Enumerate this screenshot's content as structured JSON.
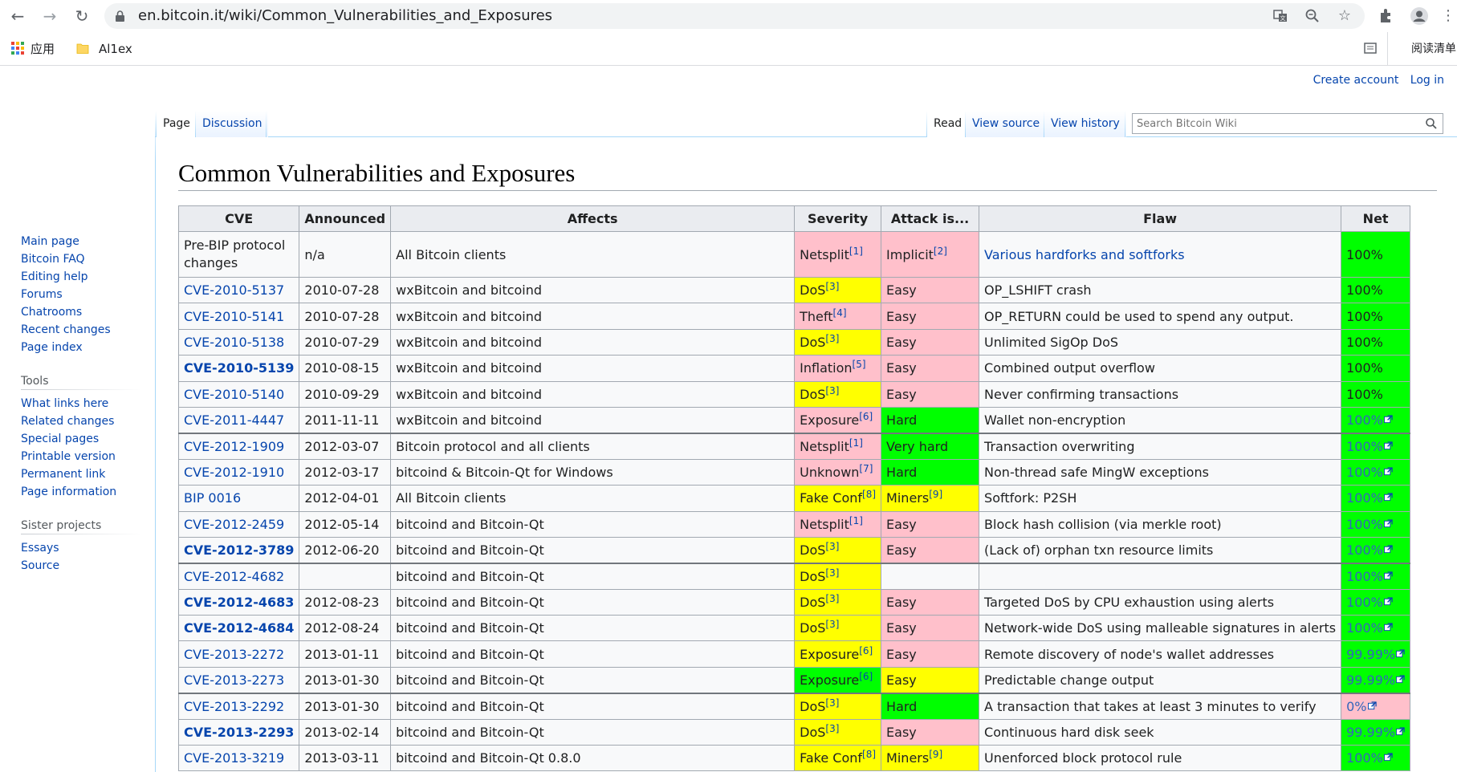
{
  "browser": {
    "url": "en.bitcoin.it/wiki/Common_Vulnerabilities_and_Exposures",
    "bookmarks": [
      {
        "label": "应用",
        "icon": "apps-grid-icon"
      },
      {
        "label": "Al1ex",
        "icon": "folder-icon"
      }
    ],
    "reading_list_label": "阅读清单"
  },
  "personal_tools": {
    "create_account": "Create account",
    "log_in": "Log in"
  },
  "tabs": {
    "page": "Page",
    "discussion": "Discussion",
    "read": "Read",
    "view_source": "View source",
    "view_history": "View history"
  },
  "search": {
    "placeholder": "Search Bitcoin Wiki"
  },
  "sidebar": {
    "navigation": [
      "Main page",
      "Bitcoin FAQ",
      "Editing help",
      "Forums",
      "Chatrooms",
      "Recent changes",
      "Page index"
    ],
    "tools_heading": "Tools",
    "tools": [
      "What links here",
      "Related changes",
      "Special pages",
      "Printable version",
      "Permanent link",
      "Page information"
    ],
    "sister_heading": "Sister projects",
    "sister": [
      "Essays",
      "Source"
    ]
  },
  "title": "Common Vulnerabilities and Exposures",
  "table": {
    "headers": [
      "CVE",
      "Announced",
      "Affects",
      "Severity",
      "Attack is...",
      "Flaw",
      "Net"
    ],
    "colors": {
      "pink": "#ffc0cb",
      "yellow": "#ffff00",
      "green": "#00ff00",
      "plain": "#f8f9fa"
    },
    "rows": [
      {
        "cve": "Pre-BIP protocol changes",
        "cve_link": false,
        "bold": false,
        "date": "n/a",
        "affects": "All Bitcoin clients",
        "severity": "Netsplit",
        "sev_ref": "[1]",
        "sev_color": "pink",
        "attack": "Implicit",
        "att_ref": "[2]",
        "att_color": "pink",
        "flaw": "Various hardforks and softforks",
        "flaw_link": true,
        "net": "100%",
        "net_ext": false,
        "net_color": "green",
        "tall": true
      },
      {
        "cve": "CVE-2010-5137",
        "cve_link": true,
        "bold": false,
        "date": "2010-07-28",
        "affects": "wxBitcoin and bitcoind",
        "severity": "DoS",
        "sev_ref": "[3]",
        "sev_color": "yellow",
        "attack": "Easy",
        "att_ref": "",
        "att_color": "pink",
        "flaw": "OP_LSHIFT crash",
        "flaw_link": false,
        "net": "100%",
        "net_ext": false,
        "net_color": "green"
      },
      {
        "cve": "CVE-2010-5141",
        "cve_link": true,
        "bold": false,
        "date": "2010-07-28",
        "affects": "wxBitcoin and bitcoind",
        "severity": "Theft",
        "sev_ref": "[4]",
        "sev_color": "pink",
        "attack": "Easy",
        "att_ref": "",
        "att_color": "pink",
        "flaw": "OP_RETURN could be used to spend any output.",
        "flaw_link": false,
        "net": "100%",
        "net_ext": false,
        "net_color": "green"
      },
      {
        "cve": "CVE-2010-5138",
        "cve_link": true,
        "bold": false,
        "date": "2010-07-29",
        "affects": "wxBitcoin and bitcoind",
        "severity": "DoS",
        "sev_ref": "[3]",
        "sev_color": "yellow",
        "attack": "Easy",
        "att_ref": "",
        "att_color": "pink",
        "flaw": "Unlimited SigOp DoS",
        "flaw_link": false,
        "net": "100%",
        "net_ext": false,
        "net_color": "green"
      },
      {
        "cve": "CVE-2010-5139",
        "cve_link": true,
        "bold": true,
        "date": "2010-08-15",
        "affects": "wxBitcoin and bitcoind",
        "severity": "Inflation",
        "sev_ref": "[5]",
        "sev_color": "pink",
        "attack": "Easy",
        "att_ref": "",
        "att_color": "pink",
        "flaw": "Combined output overflow",
        "flaw_link": false,
        "net": "100%",
        "net_ext": false,
        "net_color": "green"
      },
      {
        "cve": "CVE-2010-5140",
        "cve_link": true,
        "bold": false,
        "date": "2010-09-29",
        "affects": "wxBitcoin and bitcoind",
        "severity": "DoS",
        "sev_ref": "[3]",
        "sev_color": "yellow",
        "attack": "Easy",
        "att_ref": "",
        "att_color": "pink",
        "flaw": "Never confirming transactions",
        "flaw_link": false,
        "net": "100%",
        "net_ext": false,
        "net_color": "green"
      },
      {
        "cve": "CVE-2011-4447",
        "cve_link": true,
        "bold": false,
        "date": "2011-11-11",
        "affects": "wxBitcoin and bitcoind",
        "severity": "Exposure",
        "sev_ref": "[6]",
        "sev_color": "pink",
        "attack": "Hard",
        "att_ref": "",
        "att_color": "green",
        "flaw": "Wallet non-encryption",
        "flaw_link": false,
        "net": "100%",
        "net_ext": true,
        "net_color": "green"
      },
      {
        "cve": "CVE-2012-1909",
        "cve_link": true,
        "bold": false,
        "date": "2012-03-07",
        "affects": "Bitcoin protocol and all clients",
        "severity": "Netsplit",
        "sev_ref": "[1]",
        "sev_color": "pink",
        "attack": "Very hard",
        "att_ref": "",
        "att_color": "green",
        "flaw": "Transaction overwriting",
        "flaw_link": false,
        "net": "100%",
        "net_ext": true,
        "net_color": "green",
        "thick": true
      },
      {
        "cve": "CVE-2012-1910",
        "cve_link": true,
        "bold": false,
        "date": "2012-03-17",
        "affects": "bitcoind & Bitcoin-Qt for Windows",
        "severity": "Unknown",
        "sev_ref": "[7]",
        "sev_color": "pink",
        "attack": "Hard",
        "att_ref": "",
        "att_color": "green",
        "flaw": "Non-thread safe MingW exceptions",
        "flaw_link": false,
        "net": "100%",
        "net_ext": true,
        "net_color": "green"
      },
      {
        "cve": "BIP 0016",
        "cve_link": true,
        "bold": false,
        "date": "2012-04-01",
        "affects": "All Bitcoin clients",
        "severity": "Fake Conf",
        "sev_ref": "[8]",
        "sev_color": "yellow",
        "attack": "Miners",
        "att_ref": "[9]",
        "att_color": "yellow",
        "flaw": "Softfork: P2SH",
        "flaw_link": false,
        "net": "100%",
        "net_ext": true,
        "net_color": "green"
      },
      {
        "cve": "CVE-2012-2459",
        "cve_link": true,
        "bold": false,
        "date": "2012-05-14",
        "affects": "bitcoind and Bitcoin-Qt",
        "severity": "Netsplit",
        "sev_ref": "[1]",
        "sev_color": "pink",
        "attack": "Easy",
        "att_ref": "",
        "att_color": "pink",
        "flaw": "Block hash collision (via merkle root)",
        "flaw_link": false,
        "net": "100%",
        "net_ext": true,
        "net_color": "green"
      },
      {
        "cve": "CVE-2012-3789",
        "cve_link": true,
        "bold": true,
        "date": "2012-06-20",
        "affects": "bitcoind and Bitcoin-Qt",
        "severity": "DoS",
        "sev_ref": "[3]",
        "sev_color": "yellow",
        "attack": "Easy",
        "att_ref": "",
        "att_color": "pink",
        "flaw": "(Lack of) orphan txn resource limits",
        "flaw_link": false,
        "net": "100%",
        "net_ext": true,
        "net_color": "green"
      },
      {
        "cve": "CVE-2012-4682",
        "cve_link": true,
        "bold": false,
        "date": "",
        "affects": "bitcoind and Bitcoin-Qt",
        "severity": "DoS",
        "sev_ref": "[3]",
        "sev_color": "yellow",
        "attack": "",
        "att_ref": "",
        "att_color": "plain",
        "flaw": "",
        "flaw_link": false,
        "net": "100%",
        "net_ext": true,
        "net_color": "green",
        "thick": true
      },
      {
        "cve": "CVE-2012-4683",
        "cve_link": true,
        "bold": true,
        "date": "2012-08-23",
        "affects": "bitcoind and Bitcoin-Qt",
        "severity": "DoS",
        "sev_ref": "[3]",
        "sev_color": "yellow",
        "attack": "Easy",
        "att_ref": "",
        "att_color": "pink",
        "flaw": "Targeted DoS by CPU exhaustion using alerts",
        "flaw_link": false,
        "net": "100%",
        "net_ext": true,
        "net_color": "green"
      },
      {
        "cve": "CVE-2012-4684",
        "cve_link": true,
        "bold": true,
        "date": "2012-08-24",
        "affects": "bitcoind and Bitcoin-Qt",
        "severity": "DoS",
        "sev_ref": "[3]",
        "sev_color": "yellow",
        "attack": "Easy",
        "att_ref": "",
        "att_color": "pink",
        "flaw": "Network-wide DoS using malleable signatures in alerts",
        "flaw_link": false,
        "net": "100%",
        "net_ext": true,
        "net_color": "green"
      },
      {
        "cve": "CVE-2013-2272",
        "cve_link": true,
        "bold": false,
        "date": "2013-01-11",
        "affects": "bitcoind and Bitcoin-Qt",
        "severity": "Exposure",
        "sev_ref": "[6]",
        "sev_color": "yellow",
        "attack": "Easy",
        "att_ref": "",
        "att_color": "pink",
        "flaw": "Remote discovery of node's wallet addresses",
        "flaw_link": false,
        "net": "99.99%",
        "net_ext": true,
        "net_color": "green"
      },
      {
        "cve": "CVE-2013-2273",
        "cve_link": true,
        "bold": false,
        "date": "2013-01-30",
        "affects": "bitcoind and Bitcoin-Qt",
        "severity": "Exposure",
        "sev_ref": "[6]",
        "sev_color": "green",
        "attack": "Easy",
        "att_ref": "",
        "att_color": "yellow",
        "flaw": "Predictable change output",
        "flaw_link": false,
        "net": "99.99%",
        "net_ext": true,
        "net_color": "green"
      },
      {
        "cve": "CVE-2013-2292",
        "cve_link": true,
        "bold": false,
        "date": "2013-01-30",
        "affects": "bitcoind and Bitcoin-Qt",
        "severity": "DoS",
        "sev_ref": "[3]",
        "sev_color": "yellow",
        "attack": "Hard",
        "att_ref": "",
        "att_color": "green",
        "flaw": "A transaction that takes at least 3 minutes to verify",
        "flaw_link": false,
        "net": "0%",
        "net_ext": true,
        "net_color": "pink",
        "thick": true
      },
      {
        "cve": "CVE-2013-2293",
        "cve_link": true,
        "bold": true,
        "date": "2013-02-14",
        "affects": "bitcoind and Bitcoin-Qt",
        "severity": "DoS",
        "sev_ref": "[3]",
        "sev_color": "yellow",
        "attack": "Easy",
        "att_ref": "",
        "att_color": "pink",
        "flaw": "Continuous hard disk seek",
        "flaw_link": false,
        "net": "99.99%",
        "net_ext": true,
        "net_color": "green"
      },
      {
        "cve": "CVE-2013-3219",
        "cve_link": true,
        "bold": false,
        "date": "2013-03-11",
        "affects": "bitcoind and Bitcoin-Qt 0.8.0",
        "severity": "Fake Conf",
        "sev_ref": "[8]",
        "sev_color": "yellow",
        "attack": "Miners",
        "att_ref": "[9]",
        "att_color": "yellow",
        "flaw": "Unenforced block protocol rule",
        "flaw_link": false,
        "net": "100%",
        "net_ext": true,
        "net_color": "green"
      }
    ]
  }
}
